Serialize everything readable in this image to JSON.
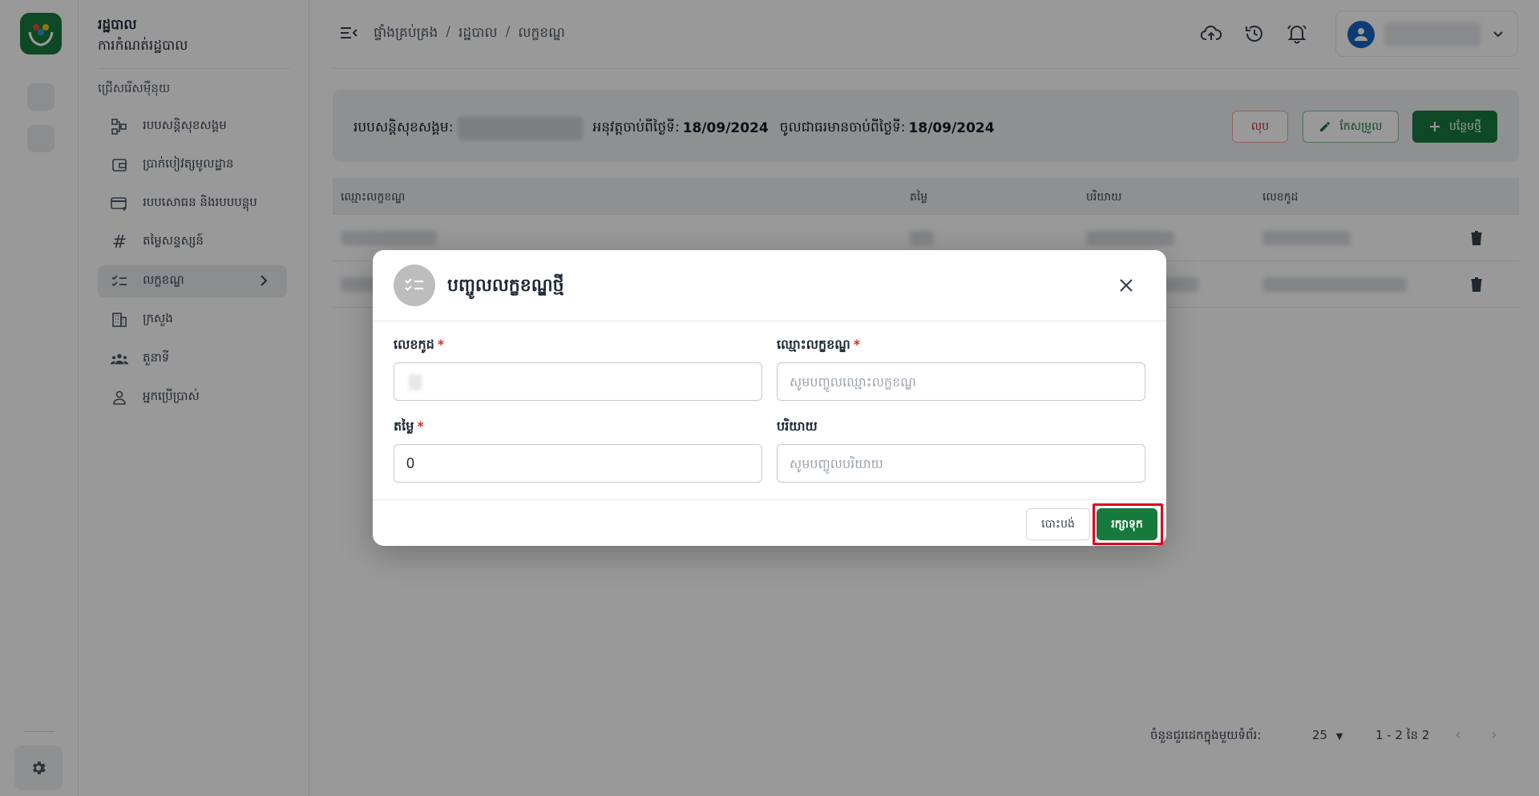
{
  "sidebar": {
    "title": "រដ្ឋបាល",
    "subtitle": "ការកំណត់រដ្ឋបាល",
    "section_label": "ជ្រើសរើសម៉ឺនុយ",
    "items": [
      {
        "label": "របបសន្តិសុខសង្គម",
        "icon": "scheme-icon"
      },
      {
        "label": "ប្រាក់បៀវត្សមូលដ្ឋាន",
        "icon": "wallet-icon"
      },
      {
        "label": "របបសោធន និងរបបបន្តុប",
        "icon": "card-icon"
      },
      {
        "label": "តម្លៃសន្ទស្សន៍",
        "icon": "hash-icon"
      },
      {
        "label": "លក្ខខណ្ឌ",
        "icon": "checklist-icon",
        "active": true
      },
      {
        "label": "ក្រសួង",
        "icon": "building-icon"
      },
      {
        "label": "តួនាទី",
        "icon": "group-icon"
      },
      {
        "label": "អ្នកប្រើប្រាស់",
        "icon": "user-icon"
      }
    ]
  },
  "breadcrumb": {
    "items": [
      "ផ្ទាំងគ្រប់គ្រង",
      "រដ្ឋបាល",
      "លក្ខខណ្ឌ"
    ],
    "separator": "/"
  },
  "topbar": {
    "icons": [
      "cloud-upload-icon",
      "history-icon",
      "bell-icon"
    ]
  },
  "info": {
    "scheme_label": "របបសន្តិសុខសង្គម:",
    "effective_label": "អនុវត្តចាប់ពីថ្ងៃទី:",
    "effective_date": "18/09/2024",
    "active_label": "ចូលជាធរមានចាប់ពីថ្ងៃទី:",
    "active_date": "18/09/2024"
  },
  "actions": {
    "delete_label": "លុប",
    "edit_label": "កែសម្រួល",
    "add_label": "បន្ថែមថ្មី"
  },
  "table": {
    "columns": [
      "ឈ្មោះលក្ខខណ្ឌ",
      "តម្លៃ",
      "បរិយាយ",
      "លេខកូដ"
    ]
  },
  "pagination": {
    "rows_label": "ចំនួនជួរដេកក្នុងមួយទំព័រ:",
    "rows_value": "25",
    "range": "1 - 2 នៃ 2"
  },
  "modal": {
    "title": "បញ្ចូលលក្ខខណ្ឌថ្មី",
    "code_label": "លេខកូដ",
    "name_label": "ឈ្មោះលក្ខខណ្ឌ",
    "name_placeholder": "សូមបញ្ចូលឈ្មោះលក្ខខណ្ឌ",
    "value_label": "តម្លៃ",
    "value_value": "0",
    "desc_label": "បរិយាយ",
    "desc_placeholder": "សូមបញ្ចូលបរិយាយ",
    "required_mark": "*",
    "cancel_label": "បោះបង់",
    "save_label": "រក្សាទុក"
  },
  "colors": {
    "brand_green": "#177a3c",
    "danger": "#c62828",
    "highlight": "#e0001b"
  }
}
